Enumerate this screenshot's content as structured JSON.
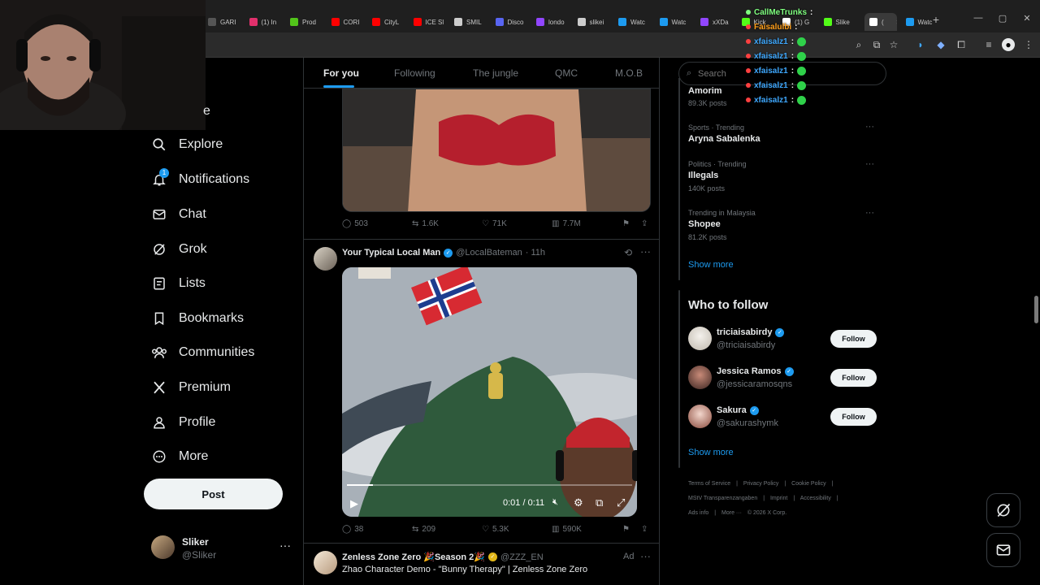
{
  "browser": {
    "tabs": [
      {
        "label": "GARI",
        "color": "#555555"
      },
      {
        "label": "(1) In",
        "color": "#e1306c"
      },
      {
        "label": "Prod",
        "color": "#52c41a"
      },
      {
        "label": "CORI",
        "color": "#ff0000"
      },
      {
        "label": "CityL",
        "color": "#ff0000"
      },
      {
        "label": "ICE Sl",
        "color": "#ff0000"
      },
      {
        "label": "SMIL",
        "color": "#cccccc"
      },
      {
        "label": "Disco",
        "color": "#5865f2"
      },
      {
        "label": "londo",
        "color": "#9146ff"
      },
      {
        "label": "slikei",
        "color": "#cccccc"
      },
      {
        "label": "Watc",
        "color": "#1d9bf0"
      },
      {
        "label": "Watc",
        "color": "#1d9bf0"
      },
      {
        "label": "xXDa",
        "color": "#9146ff"
      },
      {
        "label": "Kick",
        "color": "#53fc18"
      },
      {
        "label": "(1) G",
        "color": "#ffffff"
      },
      {
        "label": "Slike",
        "color": "#53fc18"
      },
      {
        "label": "(",
        "color": "#ffffff"
      },
      {
        "label": "Watc",
        "color": "#1d9bf0"
      }
    ]
  },
  "chat": {
    "lines": [
      {
        "user": "CallMeTrunks",
        "color": "#7fff7f",
        "dot": "#7fff7f",
        "suffix": ":"
      },
      {
        "user": "Faisalulbi",
        "color": "#ff9f1a",
        "dot": "#ff4040",
        "suffix": ":"
      },
      {
        "user": "xfaisalz1",
        "color": "#3fa9ff",
        "dot": "#ff4040",
        "suffix": ":"
      },
      {
        "user": "xfaisalz1",
        "color": "#3fa9ff",
        "dot": "#ff4040",
        "suffix": ":"
      },
      {
        "user": "xfaisalz1",
        "color": "#3fa9ff",
        "dot": "#ff4040",
        "suffix": ":"
      },
      {
        "user": "xfaisalz1",
        "color": "#3fa9ff",
        "dot": "#ff4040",
        "suffix": ":"
      },
      {
        "user": "xfaisalz1",
        "color": "#3fa9ff",
        "dot": "#ff4040",
        "suffix": ":"
      }
    ]
  },
  "nav": {
    "home_partial": "e",
    "items": [
      "Explore",
      "Notifications",
      "Chat",
      "Grok",
      "Lists",
      "Bookmarks",
      "Communities",
      "Premium",
      "Profile",
      "More"
    ],
    "notif_badge": "1",
    "post_label": "Post",
    "account": {
      "name": "Sliker",
      "handle": "@Sliker",
      "more": "···"
    }
  },
  "feed": {
    "tabs": [
      "For you",
      "Following",
      "The jungle",
      "QMC",
      "M.O.B"
    ],
    "tweet1_stats": {
      "replies": "503",
      "reposts": "1.6K",
      "likes": "71K",
      "views": "7.7M"
    },
    "tweet2": {
      "name": "Your Typical Local Man",
      "handle": "@LocalBateman",
      "time": "· 11h",
      "video_time": "0:01 / 0:11",
      "progress": 0.09,
      "stats": {
        "replies": "38",
        "reposts": "209",
        "likes": "5.3K",
        "views": "590K"
      }
    },
    "tweet3": {
      "name": "Zenless Zone Zero 🎉Season 2🎉",
      "handle": "@ZZZ_EN",
      "ad": "Ad",
      "text": "Zhao Character Demo - \"Bunny Therapy\" | Zenless Zone Zero"
    }
  },
  "right": {
    "search_placeholder": "Search",
    "trends": [
      {
        "category": "",
        "title": "Amorim",
        "count": "89.3K posts"
      },
      {
        "category": "Sports · Trending",
        "title": "Aryna Sabalenka",
        "count": ""
      },
      {
        "category": "Politics · Trending",
        "title": "Illegals",
        "count": "140K posts"
      },
      {
        "category": "Trending in Malaysia",
        "title": "Shopee",
        "count": "81.2K posts"
      }
    ],
    "show_more": "Show more",
    "who_to_follow_title": "Who to follow",
    "follow_suggestions": [
      {
        "name": "triciaisabirdy",
        "handle": "@triciaisabirdy",
        "button": "Follow"
      },
      {
        "name": "Jessica Ramos",
        "handle": "@jessicaramosqns",
        "button": "Follow"
      },
      {
        "name": "Sakura",
        "handle": "@sakurashymk",
        "button": "Follow"
      }
    ],
    "footer": {
      "line1": [
        "Terms of Service",
        "|",
        "Privacy Policy",
        "|",
        "Cookie Policy",
        "|"
      ],
      "line2": [
        "MStV Transparenzangaben",
        "|",
        "Imprint",
        "|",
        "Accessibility",
        "|"
      ],
      "line3": [
        "Ads info",
        "|",
        "More ···",
        "© 2026 X Corp."
      ]
    }
  }
}
